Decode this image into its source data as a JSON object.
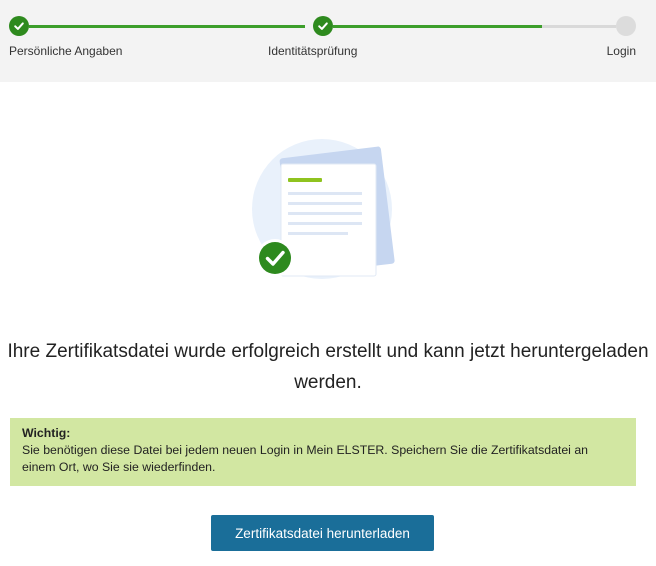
{
  "stepper": {
    "steps": [
      {
        "label": "Persönliche Angaben",
        "status": "done"
      },
      {
        "label": "Identitätsprüfung",
        "status": "done"
      },
      {
        "label": "Login",
        "status": "pending"
      }
    ],
    "colors": {
      "done": "#2e8a1e",
      "line_done": "#3c9e2a",
      "pending": "#dcdcdc"
    }
  },
  "illustration": {
    "icon": "document-check-icon",
    "accent": "#8fc31f",
    "check_color": "#2e8a1e"
  },
  "message": {
    "text": "Ihre Zertifikatsdatei wurde erfolgreich erstellt und kann jetzt heruntergeladen werden."
  },
  "important": {
    "title": "Wichtig:",
    "text": "Sie benötigen diese Datei bei jedem neuen Login in Mein ELSTER. Speichern Sie die Zertifikatsdatei an einem Ort, wo Sie sie wiederfinden.",
    "background": "#d2e7a2"
  },
  "download_button": {
    "label": "Zertifikatsdatei herunterladen",
    "color": "#1a6e99"
  }
}
